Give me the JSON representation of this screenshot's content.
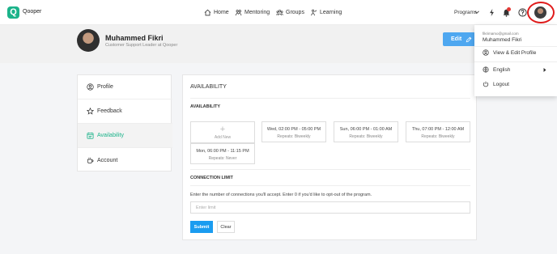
{
  "app": {
    "brand": "Qooper",
    "logo_letter": "Q",
    "accent_color": "#1bb38a"
  },
  "nav": {
    "home": "Home",
    "mentoring": "Mentoring",
    "groups": "Groups",
    "learning": "Learning",
    "programs": "Programs"
  },
  "profile": {
    "name": "Muhammed Fikri",
    "subtitle": "Customer Support Leader at Qooper",
    "edit_label": "Edit"
  },
  "sidebar": {
    "items": [
      {
        "label": "Profile",
        "icon": "user-circle-icon"
      },
      {
        "label": "Feedback",
        "icon": "star-icon"
      },
      {
        "label": "Availability",
        "icon": "calendar-icon"
      },
      {
        "label": "Account",
        "icon": "coffee-cup-icon"
      }
    ],
    "active": "Availability"
  },
  "availability": {
    "page_title": "AVAILABILITY",
    "section_title": "AVAILABILITY",
    "add_new_label": "Add New",
    "slots": [
      {
        "time": "Wed, 02:00 PM - 05:00 PM",
        "repeats": "Repeats: Biweekly"
      },
      {
        "time": "Sun, 06:00 PM - 01:00 AM",
        "repeats": "Repeats: Biweekly"
      },
      {
        "time": "Thu, 07:00 PM - 12:00 AM",
        "repeats": "Repeats: Biweekly"
      },
      {
        "time": "Mon, 06:00 PM - 11:15 PM",
        "repeats": "Repeats: Never"
      }
    ]
  },
  "connection": {
    "section_title": "CONNECTION LIMIT",
    "description": "Enter the number of connections you'll accept. Enter 0 if you'd like to opt-out of the program.",
    "placeholder": "Enter limit",
    "value": "",
    "submit_label": "Submit",
    "clear_label": "Clear"
  },
  "dropdown": {
    "email": "fikrimamo@gmail.com",
    "name": "Muhammed Fikri",
    "view_edit": "View & Edit Profile",
    "language": "English",
    "logout": "Logout"
  }
}
